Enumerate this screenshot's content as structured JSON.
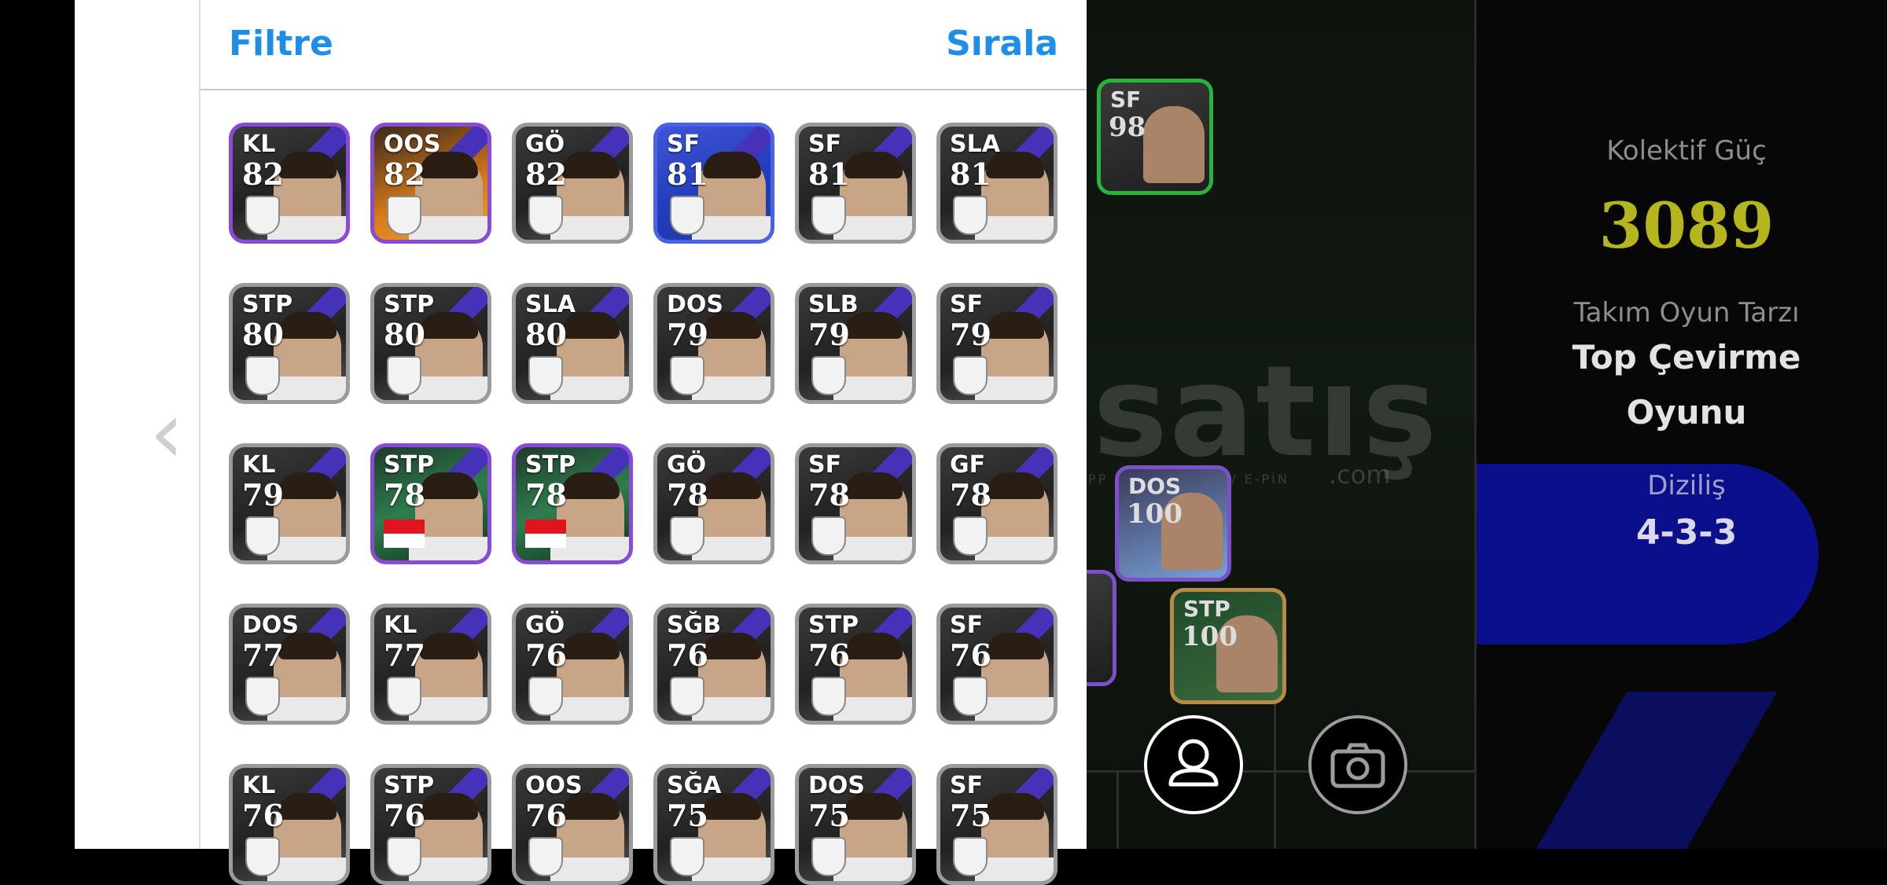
{
  "panel": {
    "filter_label": "Filtre",
    "sort_label": "Sırala"
  },
  "players": [
    {
      "pos": "KL",
      "rating": "82"
    },
    {
      "pos": "OOS",
      "rating": "82"
    },
    {
      "pos": "GÖ",
      "rating": "82"
    },
    {
      "pos": "SF",
      "rating": "81"
    },
    {
      "pos": "SF",
      "rating": "81"
    },
    {
      "pos": "SLA",
      "rating": "81"
    },
    {
      "pos": "STP",
      "rating": "80"
    },
    {
      "pos": "STP",
      "rating": "80"
    },
    {
      "pos": "SLA",
      "rating": "80"
    },
    {
      "pos": "DOS",
      "rating": "79"
    },
    {
      "pos": "SLB",
      "rating": "79"
    },
    {
      "pos": "SF",
      "rating": "79"
    },
    {
      "pos": "KL",
      "rating": "79"
    },
    {
      "pos": "STP",
      "rating": "78"
    },
    {
      "pos": "STP",
      "rating": "78"
    },
    {
      "pos": "GÖ",
      "rating": "78"
    },
    {
      "pos": "SF",
      "rating": "78"
    },
    {
      "pos": "GF",
      "rating": "78"
    },
    {
      "pos": "DOS",
      "rating": "77"
    },
    {
      "pos": "KL",
      "rating": "77"
    },
    {
      "pos": "GÖ",
      "rating": "76"
    },
    {
      "pos": "SĞB",
      "rating": "76"
    },
    {
      "pos": "STP",
      "rating": "76"
    },
    {
      "pos": "SF",
      "rating": "76"
    },
    {
      "pos": "KL",
      "rating": "76"
    },
    {
      "pos": "STP",
      "rating": "76"
    },
    {
      "pos": "OOS",
      "rating": "76"
    },
    {
      "pos": "SĞA",
      "rating": "75"
    },
    {
      "pos": "DOS",
      "rating": "75"
    },
    {
      "pos": "SF",
      "rating": "75"
    }
  ],
  "pitch": {
    "cards": [
      {
        "pos": "SF",
        "rating": "98"
      },
      {
        "pos": "DOS",
        "rating": "100"
      },
      {
        "pos": "STP",
        "rating": "100"
      }
    ],
    "watermark": "satış",
    "watermark_suffix": ".com",
    "watermark_sub": "APP / EKİN / İTEM / E-PİN"
  },
  "team": {
    "power_label": "Kolektif Güç",
    "power_value": "3089",
    "style_label": "Takım Oyun Tarzı",
    "style_value_line1": "Top Çevirme",
    "style_value_line2": "Oyunu",
    "formation_label": "Diziliş",
    "formation_value": "4-3-3"
  },
  "colors": {
    "accent_blue": "#1f8ee6",
    "power_yellow": "#b5b51e",
    "panel_blue": "#0b0f8c"
  },
  "icons": {
    "back": "chevron-left-icon",
    "profile": "user-icon",
    "camera": "camera-icon"
  }
}
